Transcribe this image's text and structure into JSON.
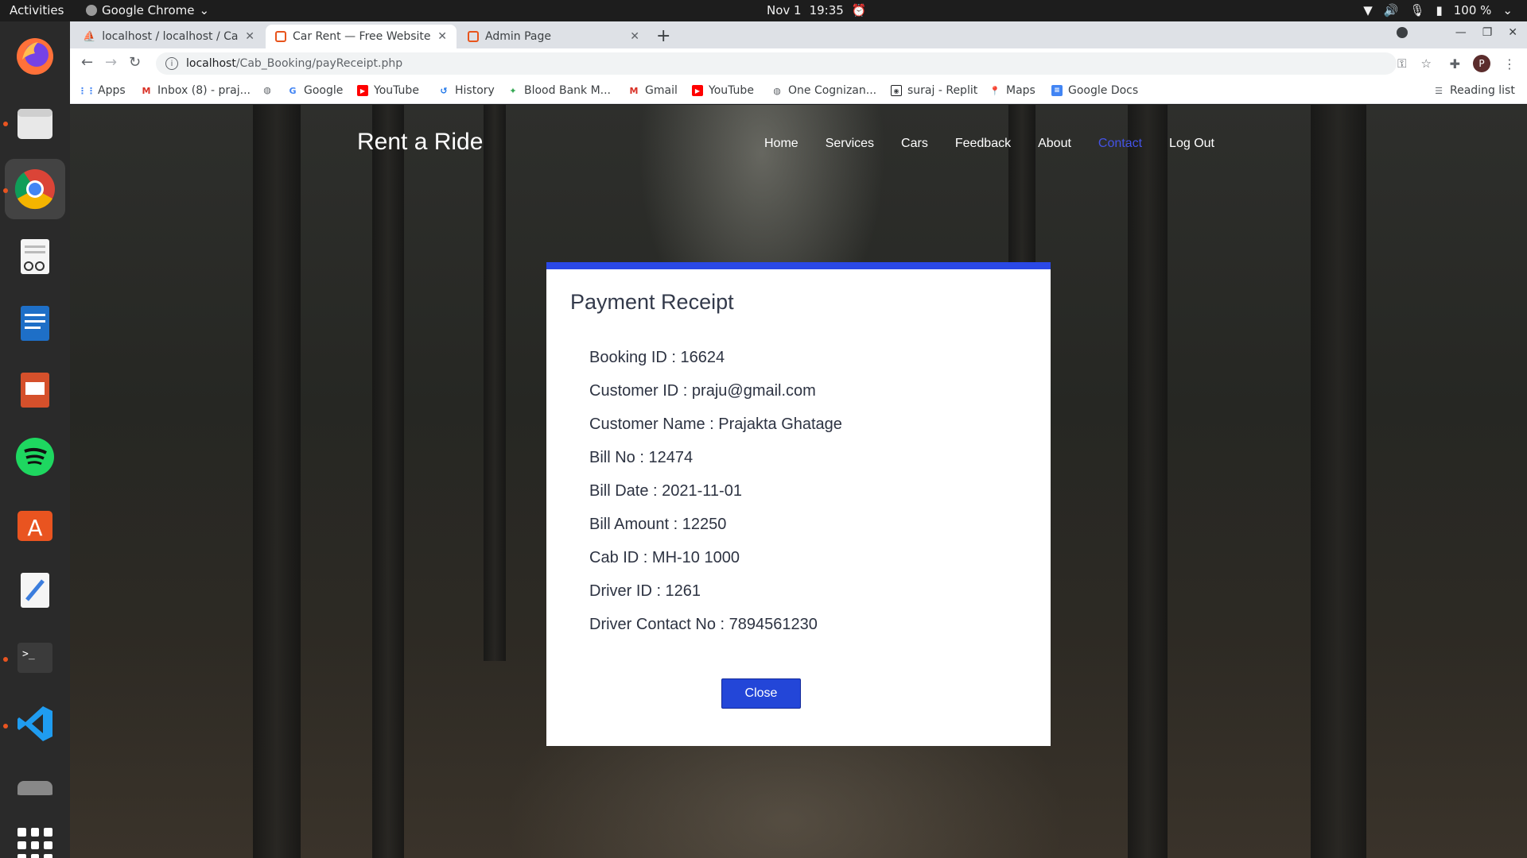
{
  "system": {
    "activities": "Activities",
    "app_name": "Google Chrome",
    "date": "Nov 1",
    "time": "19:35",
    "battery": "100 %"
  },
  "tabs": [
    {
      "title": "localhost / localhost / Cab",
      "active": false
    },
    {
      "title": "Car Rent — Free Website",
      "active": true
    },
    {
      "title": "Admin Page",
      "active": false
    }
  ],
  "address": {
    "host": "localhost",
    "path": "/Cab_Booking/payReceipt.php"
  },
  "bookmarks": [
    {
      "label": "Apps",
      "icon": "apps-grid-icon",
      "color": "#4285f4"
    },
    {
      "label": "Inbox (8) - praj...",
      "icon": "gmail-icon",
      "color": "#d93025"
    },
    {
      "label": "",
      "icon": "globe-icon",
      "color": "#5f6368"
    },
    {
      "label": "Google",
      "icon": "google-icon",
      "color": "#4285f4"
    },
    {
      "label": "YouTube",
      "icon": "youtube-icon",
      "color": "#ff0000"
    },
    {
      "label": "History",
      "icon": "history-icon",
      "color": "#1a73e8"
    },
    {
      "label": "Blood Bank M...",
      "icon": "blood-bank-icon",
      "color": "#34a853"
    },
    {
      "label": "Gmail",
      "icon": "gmail-icon",
      "color": "#d93025"
    },
    {
      "label": "YouTube",
      "icon": "youtube-icon",
      "color": "#ff0000"
    },
    {
      "label": "One Cognizan...",
      "icon": "globe-icon",
      "color": "#5f6368"
    },
    {
      "label": "suraj - Replit",
      "icon": "replit-icon",
      "color": "#202124"
    },
    {
      "label": "Maps",
      "icon": "maps-icon",
      "color": "#34a853"
    },
    {
      "label": "Google Docs",
      "icon": "docs-icon",
      "color": "#4285f4"
    }
  ],
  "reading_list": "Reading list",
  "profile_initial": "P",
  "site": {
    "brand": "Rent a Ride",
    "nav": [
      "Home",
      "Services",
      "Cars",
      "Feedback",
      "About",
      "Contact",
      "Log Out"
    ],
    "nav_active": "Contact",
    "accent_color": "#2a48e6"
  },
  "receipt": {
    "title": "Payment Receipt",
    "rows": [
      "Booking ID : 16624",
      "Customer ID : praju@gmail.com",
      "Customer Name : Prajakta Ghatage",
      "Bill No : 12474",
      "Bill Date : 2021-11-01",
      "Bill Amount : 12250",
      "Cab ID : MH-10 1000",
      "Driver ID : 1261",
      "Driver Contact No : 7894561230"
    ],
    "close_label": "Close"
  }
}
